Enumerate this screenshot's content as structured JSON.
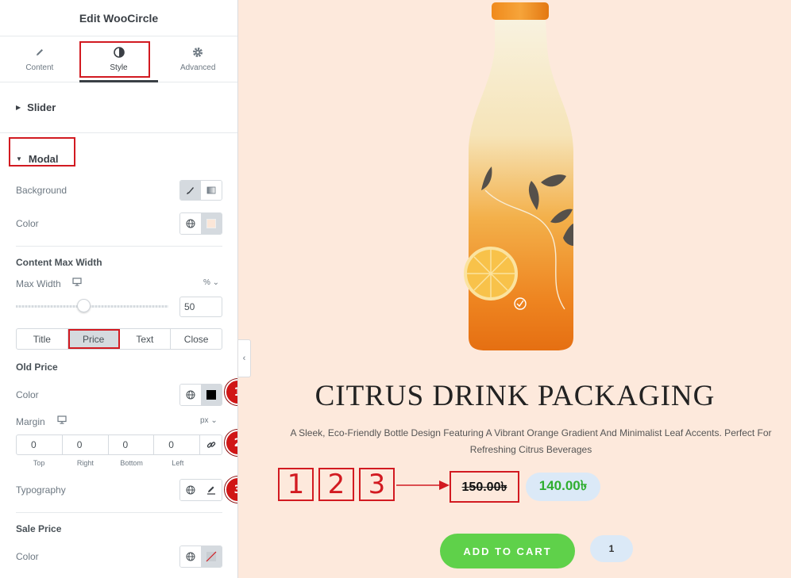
{
  "panel": {
    "title": "Edit WooCircle",
    "tabs": [
      {
        "label": "Content",
        "icon": "pencil-icon"
      },
      {
        "label": "Style",
        "icon": "half-circle-icon"
      },
      {
        "label": "Advanced",
        "icon": "gear-icon"
      }
    ],
    "sections": {
      "slider": "Slider",
      "modal": "Modal"
    },
    "background_label": "Background",
    "color_label": "Color",
    "content_max_width": "Content Max Width",
    "max_width_label": "Max Width",
    "max_width_unit": "% ⌄",
    "max_width_value": "50",
    "max_width_level": 0.5,
    "style_tabs": [
      "Title",
      "Price",
      "Text",
      "Close"
    ],
    "old_price_heading": "Old Price",
    "old_price_color_label": "Color",
    "margin_label": "Margin",
    "margin_unit": "px ⌄",
    "margin": {
      "top": "0",
      "right": "0",
      "bottom": "0",
      "left": "0"
    },
    "margin_labels": [
      "Top",
      "Right",
      "Bottom",
      "Left"
    ],
    "typography_label": "Typography",
    "sale_price_heading": "Sale Price",
    "sale_price_color_label": "Color",
    "badges": [
      "1",
      "2",
      "3"
    ]
  },
  "preview": {
    "product_title": "CITRUS DRINK PACKAGING",
    "description": "A Sleek, Eco-Friendly Bottle Design Featuring A Vibrant Orange Gradient And Minimalist Leaf Accents. Perfect For Refreshing Citrus Beverages",
    "annotation_numbers": [
      "1",
      "2",
      "3"
    ],
    "old_price": "150.00৳",
    "sale_price": "140.00৳",
    "add_to_cart": "ADD TO CART",
    "quantity": "1"
  },
  "colors": {
    "accent_red": "#d21a21",
    "preview_bg": "#fde9dc",
    "sale_green": "#2fae2f",
    "cart_green": "#5fd14a"
  }
}
